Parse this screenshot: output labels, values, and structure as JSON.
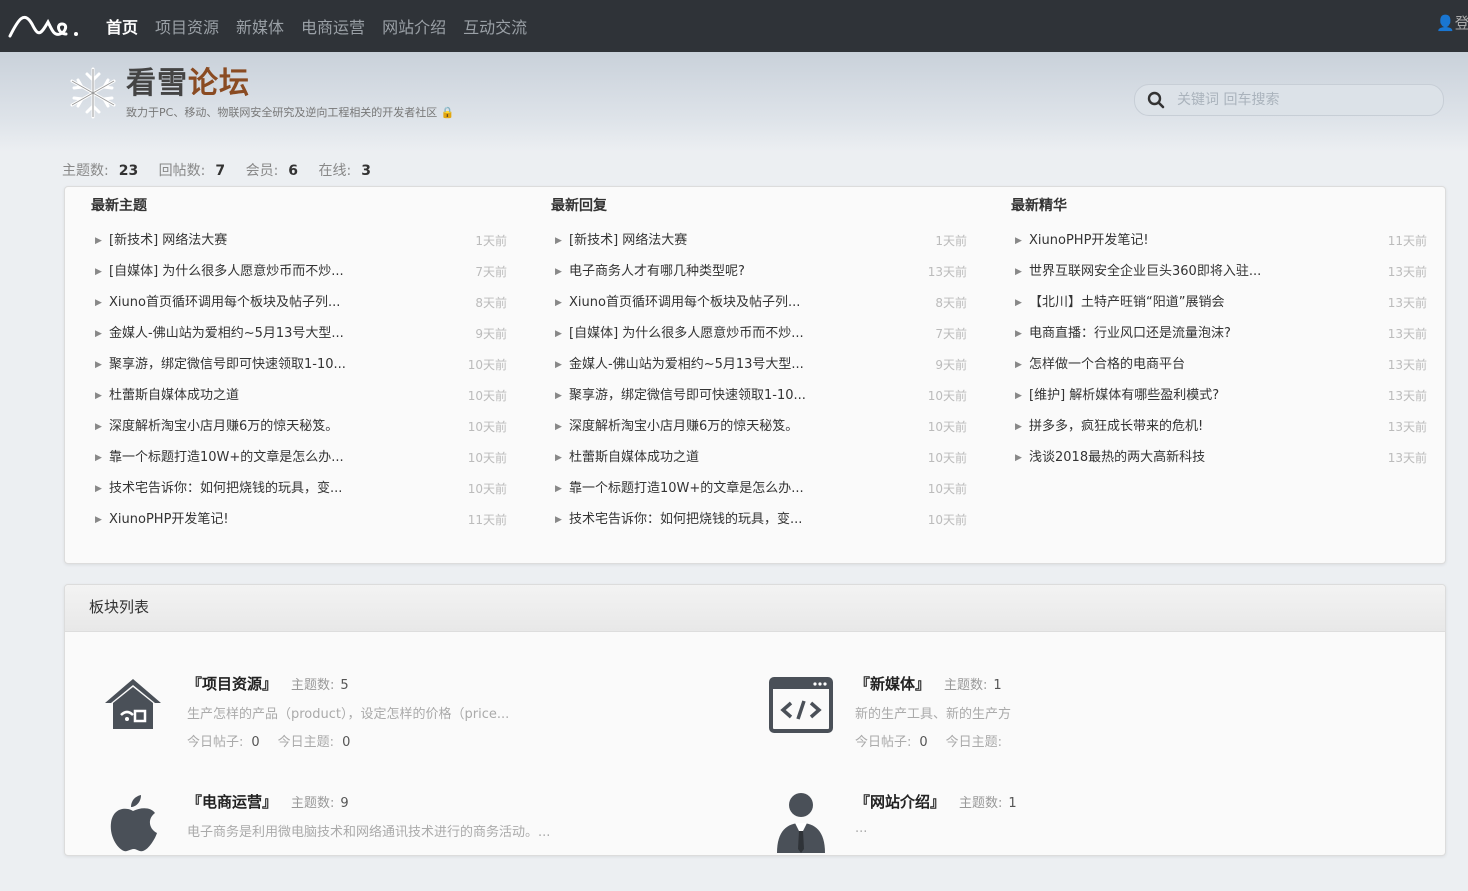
{
  "nav": {
    "items": [
      "首页",
      "项目资源",
      "新媒体",
      "电商运营",
      "网站介绍",
      "互动交流"
    ],
    "active_index": 0,
    "user_label": "登录"
  },
  "brand": {
    "title_part1": "看雪",
    "title_part2": "论坛",
    "subtitle": "致力于PC、移动、物联网安全研究及逆向工程相关的开发者社区"
  },
  "search": {
    "placeholder": "关键词 回车搜索"
  },
  "stats": {
    "topics_label": "主题数:",
    "topics": "23",
    "replies_label": "回帖数:",
    "replies": "7",
    "members_label": "会员:",
    "members": "6",
    "online_label": "在线:",
    "online": "3"
  },
  "latest_topics": {
    "title": "最新主题",
    "items": [
      {
        "text": "[新技术] 网络法大赛",
        "time": "1天前"
      },
      {
        "text": "[自媒体] 为什么很多人愿意炒币而不炒...",
        "time": "7天前"
      },
      {
        "text": "Xiuno首页循环调用每个板块及帖子列...",
        "time": "8天前"
      },
      {
        "text": "金媒人-佛山站为爱相约~5月13号大型...",
        "time": "9天前"
      },
      {
        "text": "聚享游，绑定微信号即可快速领取1-10...",
        "time": "10天前"
      },
      {
        "text": "杜蕾斯自媒体成功之道",
        "time": "10天前"
      },
      {
        "text": "深度解析淘宝小店月赚6万的惊天秘笈。",
        "time": "10天前"
      },
      {
        "text": "靠一个标题打造10W+的文章是怎么办...",
        "time": "10天前"
      },
      {
        "text": "技术宅告诉你：如何把烧钱的玩具，变...",
        "time": "10天前"
      },
      {
        "text": "XiunoPHP开发笔记!",
        "time": "11天前"
      }
    ]
  },
  "latest_replies": {
    "title": "最新回复",
    "items": [
      {
        "text": "[新技术] 网络法大赛",
        "time": "1天前"
      },
      {
        "text": "电子商务人才有哪几种类型呢?",
        "time": "13天前"
      },
      {
        "text": "Xiuno首页循环调用每个板块及帖子列...",
        "time": "8天前"
      },
      {
        "text": "[自媒体] 为什么很多人愿意炒币而不炒...",
        "time": "7天前"
      },
      {
        "text": "金媒人-佛山站为爱相约~5月13号大型...",
        "time": "9天前"
      },
      {
        "text": "聚享游，绑定微信号即可快速领取1-10...",
        "time": "10天前"
      },
      {
        "text": "深度解析淘宝小店月赚6万的惊天秘笈。",
        "time": "10天前"
      },
      {
        "text": "杜蕾斯自媒体成功之道",
        "time": "10天前"
      },
      {
        "text": "靠一个标题打造10W+的文章是怎么办...",
        "time": "10天前"
      },
      {
        "text": "技术宅告诉你：如何把烧钱的玩具，变...",
        "time": "10天前"
      }
    ]
  },
  "latest_digest": {
    "title": "最新精华",
    "items": [
      {
        "text": "XiunoPHP开发笔记!",
        "time": "11天前"
      },
      {
        "text": "世界互联网安全企业巨头360即将入驻...",
        "time": "13天前"
      },
      {
        "text": "【北川】土特产旺销“阳道”展销会",
        "time": "13天前"
      },
      {
        "text": "电商直播：行业风口还是流量泡沫?",
        "time": "13天前"
      },
      {
        "text": "怎样做一个合格的电商平台",
        "time": "13天前"
      },
      {
        "text": "[维护] 解析媒体有哪些盈利模式?",
        "time": "13天前"
      },
      {
        "text": "拼多多，疯狂成长带来的危机!",
        "time": "13天前"
      },
      {
        "text": "浅谈2018最热的两大高新科技",
        "time": "13天前"
      }
    ]
  },
  "boards": {
    "title": "板块列表",
    "topics_label": "主题数:",
    "today_posts_label": "今日帖子:",
    "today_topics_label": "今日主题:",
    "items": [
      {
        "name": "『项目资源』",
        "topics": "5",
        "desc": "生产怎样的产品（product），设定怎样的价格（price...",
        "today_posts": "0",
        "today_topics": "0",
        "icon": "house-icon"
      },
      {
        "name": "『新媒体』",
        "topics": "1",
        "desc": "新的生产工具、新的生产方",
        "today_posts": "0",
        "today_topics": "",
        "icon": "code-window-icon"
      },
      {
        "name": "『电商运营』",
        "topics": "9",
        "desc": "电子商务是利用微电脑技术和网络通讯技术进行的商务活动。...",
        "today_posts": "",
        "today_topics": "",
        "icon": "apple-icon"
      },
      {
        "name": "『网站介绍』",
        "topics": "1",
        "desc": "...",
        "today_posts": "",
        "today_topics": "",
        "icon": "user-icon"
      }
    ]
  }
}
